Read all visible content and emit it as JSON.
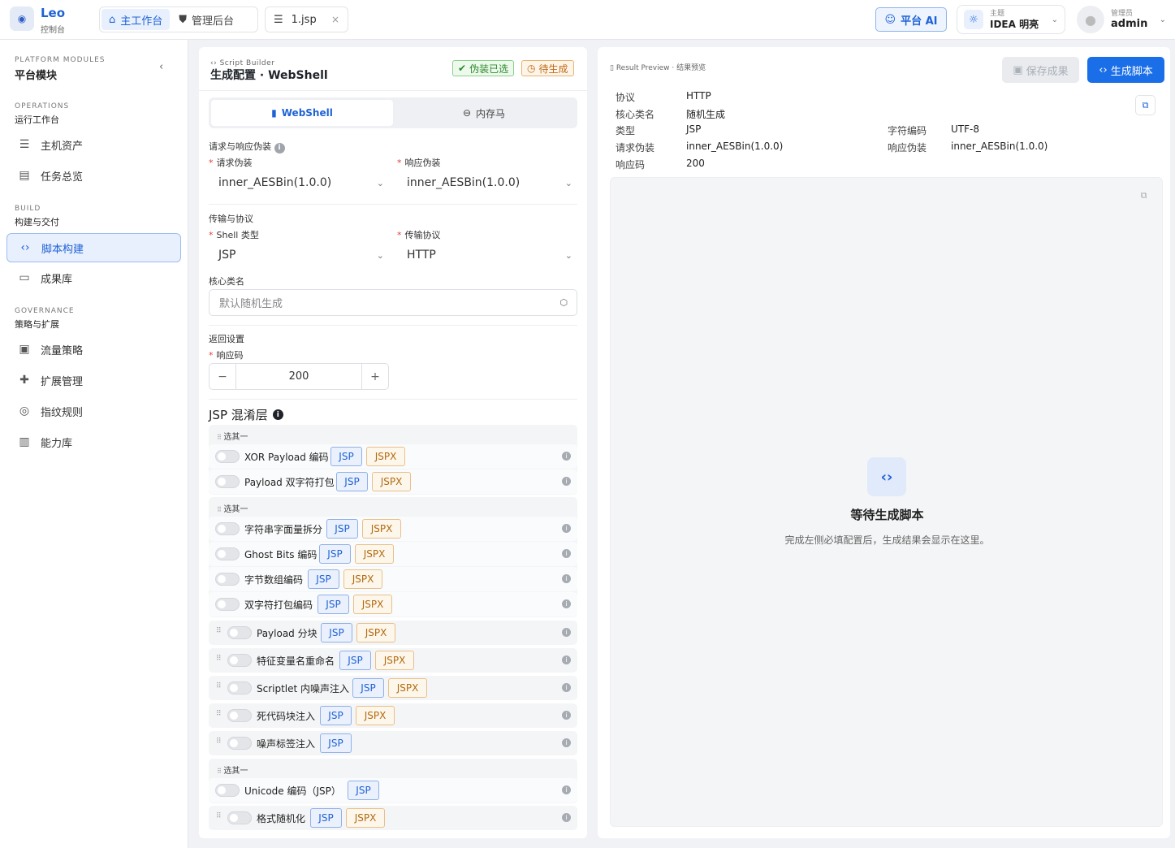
{
  "brand": {
    "name": "Leo",
    "sub": "控制台"
  },
  "nav": {
    "workbench": "主工作台",
    "admin": "管理后台"
  },
  "file_tab": {
    "name": "1.jsp",
    "close": "×"
  },
  "ai_button": "平台 AI",
  "theme": {
    "label": "主题",
    "value": "IDEA 明亮"
  },
  "user": {
    "role": "管理员",
    "name": "admin"
  },
  "sidebar": {
    "header_en": "PLATFORM MODULES",
    "header_zh": "平台模块",
    "sections": [
      {
        "en": "OPERATIONS",
        "zh": "运行工作台",
        "items": [
          {
            "label": "主机资产",
            "icon": "server-icon"
          },
          {
            "label": "任务总览",
            "icon": "clipboard-icon"
          }
        ]
      },
      {
        "en": "BUILD",
        "zh": "构建与交付",
        "items": [
          {
            "label": "脚本构建",
            "icon": "code-icon",
            "active": true
          },
          {
            "label": "成果库",
            "icon": "folder-icon"
          }
        ]
      },
      {
        "en": "GOVERNANCE",
        "zh": "策略与扩展",
        "items": [
          {
            "label": "流量策略",
            "icon": "monitor-icon"
          },
          {
            "label": "扩展管理",
            "icon": "puzzle-icon"
          },
          {
            "label": "指纹规则",
            "icon": "fingerprint-icon"
          },
          {
            "label": "能力库",
            "icon": "book-icon"
          }
        ]
      }
    ]
  },
  "config": {
    "crumb": "Script Builder",
    "title": "生成配置 · WebShell",
    "badge_ok": "伪装已选",
    "badge_pending": "待生成",
    "tabs": {
      "webshell": "WebShell",
      "memshell": "内存马"
    },
    "disguise_section": "请求与响应伪装",
    "request_label": "请求伪装",
    "request_value": "inner_AESBin(1.0.0)",
    "response_label": "响应伪装",
    "response_value": "inner_AESBin(1.0.0)",
    "transport_section": "传输与协议",
    "shell_label": "Shell 类型",
    "shell_value": "JSP",
    "protocol_label": "传输协议",
    "protocol_value": "HTTP",
    "class_label": "核心类名",
    "class_placeholder": "默认随机生成",
    "return_section": "返回设置",
    "code_label": "响应码",
    "code_value": "200",
    "obf_title": "JSP 混淆层",
    "group_label": "选其一",
    "obf_items": [
      {
        "label": "XOR Payload 编码",
        "jsp": "JSP",
        "jspx": "JSPX"
      },
      {
        "label": "Payload 双字符打包",
        "jsp": "JSP",
        "jspx": "JSPX"
      },
      {
        "label": "字符串字面量拆分",
        "jsp": "JSP",
        "jspx": "JSPX"
      },
      {
        "label": "Ghost Bits 编码",
        "jsp": "JSP",
        "jspx": "JSPX"
      },
      {
        "label": "字节数组编码",
        "jsp": "JSP",
        "jspx": "JSPX"
      },
      {
        "label": "双字符打包编码",
        "jsp": "JSP",
        "jspx": "JSPX"
      },
      {
        "label": "Payload 分块",
        "jsp": "JSP",
        "jspx": "JSPX"
      },
      {
        "label": "特征变量名重命名",
        "jsp": "JSP",
        "jspx": "JSPX"
      },
      {
        "label": "Scriptlet 内噪声注入",
        "jsp": "JSP",
        "jspx": "JSPX"
      },
      {
        "label": "死代码块注入",
        "jsp": "JSP",
        "jspx": "JSPX"
      },
      {
        "label": "噪声标签注入",
        "jsp": "JSP"
      },
      {
        "label": "Unicode 编码（JSP）",
        "jsp": "JSP"
      },
      {
        "label": "格式随机化",
        "jsp": "JSP",
        "jspx": "JSPX"
      }
    ]
  },
  "result": {
    "crumb": "Result Preview · 结果预览",
    "save": "保存成果",
    "generate": "生成脚本",
    "k_protocol": "协议",
    "v_protocol": "HTTP",
    "k_class": "核心类名",
    "v_class": "随机生成",
    "k_type": "类型",
    "v_type": "JSP",
    "k_charset": "字符编码",
    "v_charset": "UTF-8",
    "k_req": "请求伪装",
    "v_req": "inner_AESBin(1.0.0)",
    "k_resp": "响应伪装",
    "v_resp": "inner_AESBin(1.0.0)",
    "k_code": "响应码",
    "v_code": "200",
    "empty_title": "等待生成脚本",
    "empty_sub": "完成左侧必填配置后，生成结果会显示在这里。"
  }
}
